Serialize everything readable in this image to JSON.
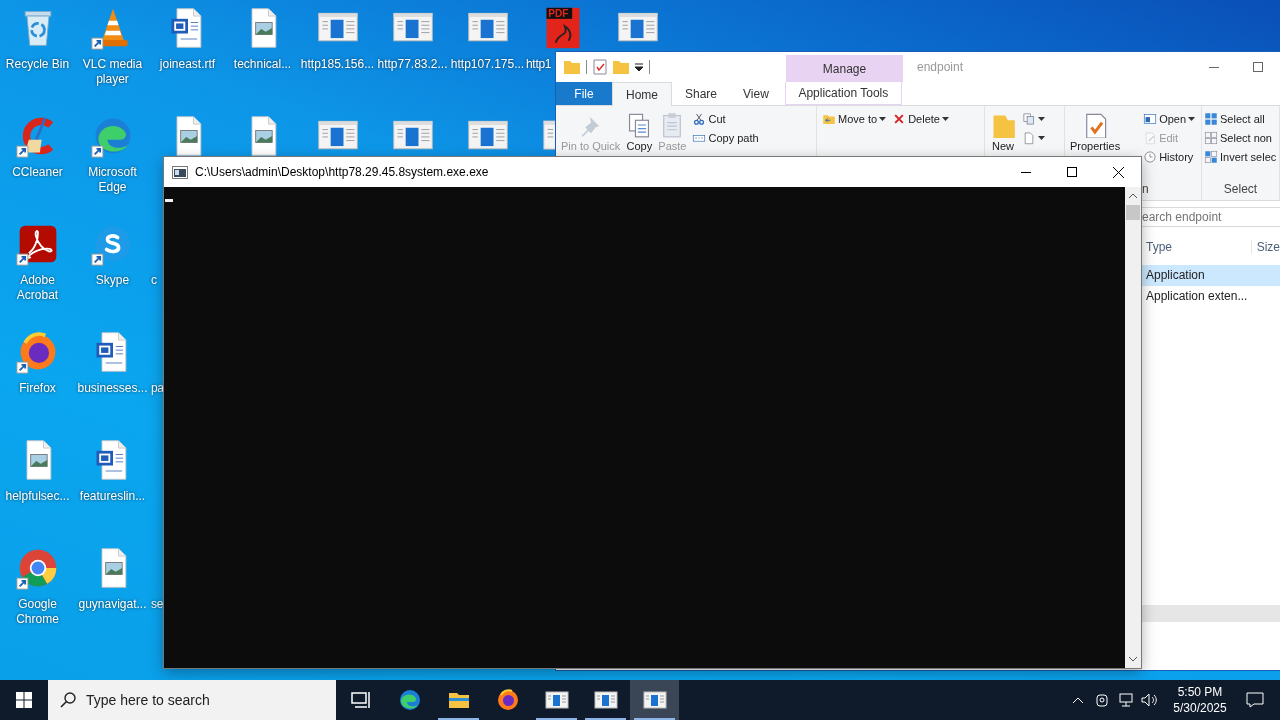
{
  "desktop": {
    "columns": [
      [
        {
          "kind": "recycle-bin",
          "label": "Recycle Bin",
          "shortcut": false
        },
        {
          "kind": "ccleaner",
          "label": "CCleaner",
          "shortcut": true
        },
        {
          "kind": "acrobat",
          "label": "Adobe Acrobat",
          "shortcut": true
        },
        {
          "kind": "firefox",
          "label": "Firefox",
          "shortcut": true
        },
        {
          "kind": "image-file",
          "label": "helpfulsec...",
          "shortcut": false
        },
        {
          "kind": "chrome",
          "label": "Google Chrome",
          "shortcut": true
        }
      ],
      [
        {
          "kind": "vlc",
          "label": "VLC media player",
          "shortcut": true
        },
        {
          "kind": "edge",
          "label": "Microsoft Edge",
          "shortcut": true
        },
        {
          "kind": "skype",
          "label": "Skype",
          "shortcut": true
        },
        {
          "kind": "word-doc",
          "label": "businesses...",
          "shortcut": false
        },
        {
          "kind": "word-doc",
          "label": "featureslin...",
          "shortcut": false
        },
        {
          "kind": "image-file",
          "label": "guynavigat...",
          "shortcut": false
        }
      ],
      [
        {
          "kind": "word-doc",
          "label": "joineast.rtf",
          "shortcut": false
        },
        {
          "kind": "image-file",
          "shortcut": false
        },
        {
          "kind": "covered",
          "label": "c",
          "clipped": true
        },
        {
          "kind": "covered",
          "label": "pa",
          "clipped": true
        },
        {
          "kind": "covered"
        },
        {
          "kind": "covered",
          "label": "se",
          "clipped": true
        }
      ],
      [
        {
          "kind": "image-file",
          "label": "technical...",
          "shortcut": false
        },
        {
          "kind": "image-file",
          "shortcut": false
        }
      ],
      [
        {
          "kind": "app-window",
          "label": "http185.156...",
          "shortcut": false
        },
        {
          "kind": "app-window",
          "shortcut": false
        }
      ],
      [
        {
          "kind": "app-window",
          "label": "http77.83.2...",
          "shortcut": false
        },
        {
          "kind": "app-window",
          "shortcut": false
        }
      ],
      [
        {
          "kind": "app-window",
          "label": "http107.175...",
          "shortcut": false
        },
        {
          "kind": "app-window",
          "shortcut": false
        }
      ],
      [
        {
          "kind": "pdf",
          "badge": "PDF",
          "label": "http1",
          "clipped": true,
          "shortcut": false
        },
        {
          "kind": "app-window",
          "shortcut": false,
          "clipped": true
        }
      ],
      [
        {
          "kind": "app-window",
          "shortcut": false
        }
      ]
    ]
  },
  "explorer": {
    "context_label": "Manage",
    "title": "endpoint",
    "tabs": [
      {
        "label": "File",
        "kind": "file",
        "selected": false
      },
      {
        "label": "Home",
        "kind": "tab",
        "selected": true
      },
      {
        "label": "Share",
        "kind": "tab",
        "selected": false
      },
      {
        "label": "View",
        "kind": "tab",
        "selected": false
      },
      {
        "label": "Application Tools",
        "kind": "context",
        "selected": false
      }
    ],
    "ribbon": [
      {
        "columns": [
          [
            {
              "kind": "large",
              "label": "Pin to Quick",
              "disabled": true
            }
          ],
          [
            {
              "kind": "large",
              "label": "Copy",
              "disabled": false
            }
          ],
          [
            {
              "kind": "large",
              "label": "Paste",
              "disabled": true
            }
          ],
          [
            {
              "kind": "small",
              "label": "Cut",
              "disabled": false
            },
            {
              "kind": "small",
              "label": "Copy path",
              "disabled": false
            }
          ]
        ]
      },
      {
        "columns": [
          [
            {
              "kind": "small",
              "label": "Move to",
              "disabled": false,
              "dropdown": true
            }
          ],
          [
            {
              "kind": "small",
              "label": "Delete",
              "disabled": false,
              "dropdown": true
            }
          ]
        ]
      },
      {
        "columns": [
          [
            {
              "kind": "large",
              "label": "New",
              "disabled": false
            }
          ],
          [
            {
              "kind": "icon",
              "disabled": false,
              "dropdown": true
            },
            {
              "kind": "icon",
              "disabled": false,
              "dropdown": true
            }
          ]
        ]
      },
      {
        "label": "n",
        "columns": [
          [
            {
              "kind": "large",
              "label": "Properties",
              "disabled": false
            }
          ],
          [
            {
              "kind": "small",
              "label": "Open",
              "disabled": false,
              "dropdown": true
            },
            {
              "kind": "small",
              "label": "Edit",
              "disabled": true
            },
            {
              "kind": "small",
              "label": "History",
              "disabled": false
            }
          ]
        ]
      },
      {
        "label": "Select",
        "columns": [
          [
            {
              "kind": "small",
              "label": "Select all",
              "disabled": false
            },
            {
              "kind": "small",
              "label": "Select non",
              "disabled": false
            },
            {
              "kind": "small",
              "label": "Invert selec",
              "disabled": false
            }
          ]
        ]
      }
    ],
    "search_placeholder": "earch endpoint",
    "columns": [
      "Type",
      "Size"
    ],
    "rows": [
      {
        "type": "Application",
        "selected": true
      },
      {
        "type": "Application exten...",
        "selected": false
      }
    ]
  },
  "console": {
    "title": "C:\\Users\\admin\\Desktop\\http78.29.45.8system.exe.exe"
  },
  "taskbar": {
    "search_placeholder": "Type here to search",
    "apps": [
      {
        "kind": "task-view",
        "running": false,
        "selected": false
      },
      {
        "kind": "edge",
        "running": false,
        "selected": false
      },
      {
        "kind": "explorer",
        "running": true,
        "selected": false
      },
      {
        "kind": "firefox",
        "running": false,
        "selected": false
      },
      {
        "kind": "app-window",
        "running": true,
        "selected": false
      },
      {
        "kind": "app-window",
        "running": true,
        "selected": false
      },
      {
        "kind": "app-window",
        "running": true,
        "selected": true
      }
    ],
    "time": "5:50 PM",
    "date": "5/30/2025"
  }
}
